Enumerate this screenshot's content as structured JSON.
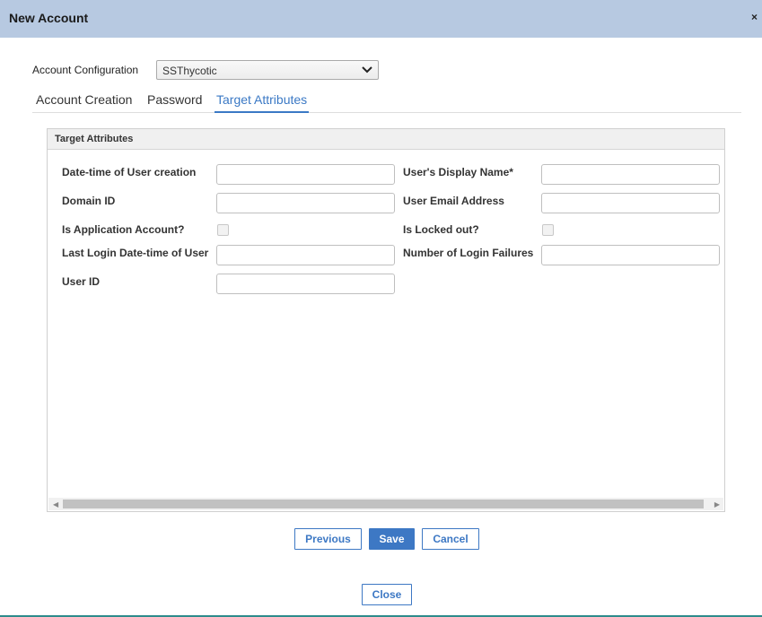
{
  "dialog": {
    "title": "New Account",
    "close_glyph": "×"
  },
  "config": {
    "label": "Account Configuration",
    "selected": "SSThycotic"
  },
  "tabs": [
    {
      "label": "Account Creation",
      "active": false
    },
    {
      "label": "Password",
      "active": false
    },
    {
      "label": "Target Attributes",
      "active": true
    }
  ],
  "panel": {
    "title": "Target Attributes"
  },
  "fields": {
    "date_time_user_creation": {
      "label": "Date-time of User creation",
      "value": ""
    },
    "domain_id": {
      "label": "Domain ID",
      "value": ""
    },
    "is_application_account": {
      "label": "Is Application Account?",
      "checked": false
    },
    "last_login": {
      "label": "Last Login Date-time of User",
      "value": ""
    },
    "user_id": {
      "label": "User ID",
      "value": ""
    },
    "display_name": {
      "label": "User's Display Name*",
      "value": ""
    },
    "email": {
      "label": "User Email Address",
      "value": ""
    },
    "is_locked_out": {
      "label": "Is Locked out?",
      "checked": false
    },
    "login_failures": {
      "label": "Number of Login Failures",
      "value": ""
    }
  },
  "buttons": {
    "previous": "Previous",
    "save": "Save",
    "cancel": "Cancel",
    "close": "Close"
  },
  "colors": {
    "titlebar": "#b7c9e1",
    "accent": "#3d78c4",
    "bottom_line": "#2e8c8c"
  },
  "icons": {
    "select_arrow": "chevron-down-icon",
    "scroll_left": "arrow-left-icon",
    "scroll_right": "arrow-right-icon"
  }
}
